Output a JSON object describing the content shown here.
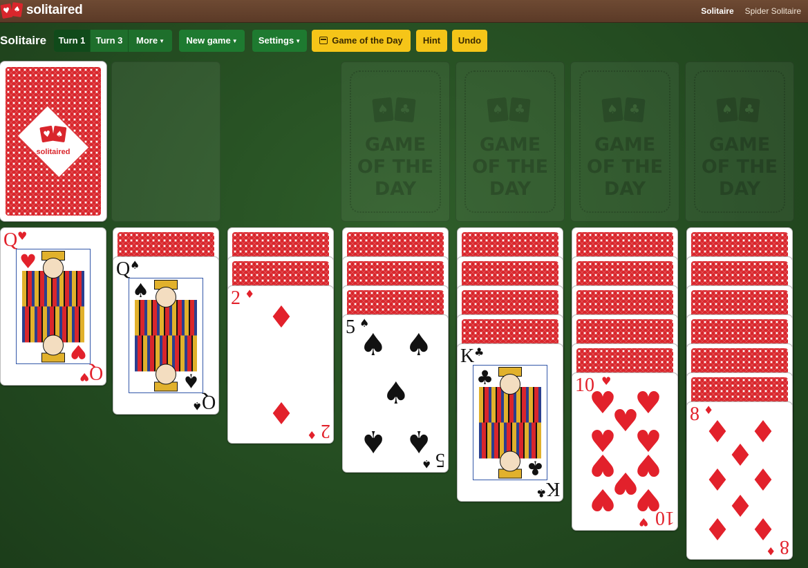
{
  "brand": {
    "name": "solitaired",
    "logo_suits": [
      "♥",
      "♠"
    ]
  },
  "nav": {
    "active": "Solitaire",
    "link": "Spider Solitaire"
  },
  "toolbar": {
    "title": "Solitaire",
    "turn1": "Turn 1",
    "turn3": "Turn 3",
    "more": "More",
    "new_game": "New game",
    "settings": "Settings",
    "game_of_day": "Game of the Day",
    "hint": "Hint",
    "undo": "Undo"
  },
  "foundations": {
    "placeholder_lines": [
      "GAME",
      "OF THE",
      "DAY"
    ],
    "placeholder_suits": [
      "♠",
      "♣"
    ]
  },
  "stock": {
    "brand": "solitaired"
  },
  "tableau": [
    {
      "face_down": 0,
      "face_up": {
        "rank": "Q",
        "suit": "♥",
        "color": "red",
        "court": true
      }
    },
    {
      "face_down": 1,
      "face_up": {
        "rank": "Q",
        "suit": "♠",
        "color": "black",
        "court": true
      }
    },
    {
      "face_down": 2,
      "face_up": {
        "rank": "2",
        "suit": "♦",
        "color": "red",
        "court": false
      }
    },
    {
      "face_down": 3,
      "face_up": {
        "rank": "5",
        "suit": "♠",
        "color": "black",
        "court": false
      }
    },
    {
      "face_down": 4,
      "face_up": {
        "rank": "K",
        "suit": "♣",
        "color": "black",
        "court": true
      }
    },
    {
      "face_down": 5,
      "face_up": {
        "rank": "10",
        "suit": "♥",
        "color": "red",
        "court": false
      }
    },
    {
      "face_down": 6,
      "face_up": {
        "rank": "8",
        "suit": "♦",
        "color": "red",
        "court": false
      }
    }
  ],
  "colors": {
    "felt": "#234a20",
    "topbar": "#5b3a27",
    "button_green": "#1e7a30",
    "button_yellow": "#f5c518",
    "card_red": "#e2212b"
  }
}
